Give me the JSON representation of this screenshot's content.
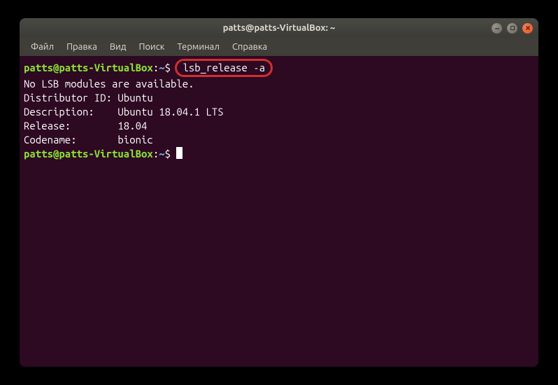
{
  "window": {
    "title": "patts@patts-VirtualBox: ~"
  },
  "menu": {
    "file": "Файл",
    "edit": "Правка",
    "view": "Вид",
    "search": "Поиск",
    "terminal": "Терминал",
    "help": "Справка"
  },
  "terminal": {
    "prompt_user": "patts@patts-VirtualBox",
    "prompt_colon": ":",
    "prompt_path": "~",
    "prompt_dollar": "$",
    "command1": "lsb_release -a",
    "out1": "No LSB modules are available.",
    "out2": "Distributor ID: Ubuntu",
    "out3": "Description:    Ubuntu 18.04.1 LTS",
    "out4": "Release:        18.04",
    "out5": "Codename:       bionic"
  },
  "icons": {
    "minimize": "minimize-icon",
    "maximize": "maximize-icon",
    "close": "close-icon"
  }
}
